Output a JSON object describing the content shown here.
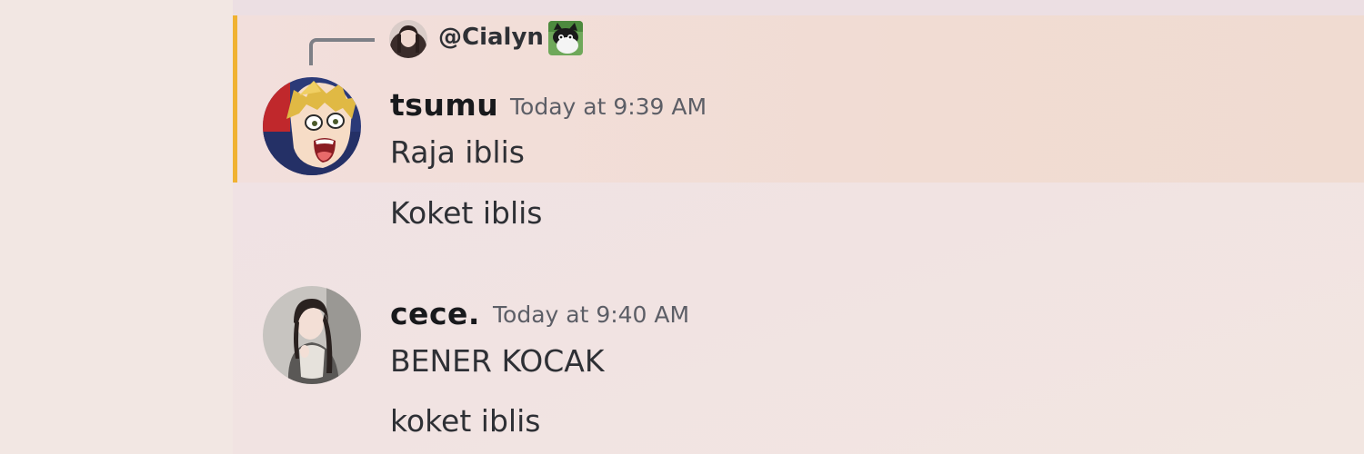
{
  "reply_preview": {
    "mention": "@Cialyn",
    "avatar_icon": "user-avatar",
    "emoji_icon": "cat-emoji"
  },
  "messages": [
    {
      "username": "tsumu",
      "timestamp": "Today at 9:39 AM",
      "avatar_icon": "anime-avatar",
      "lines": [
        "Raja iblis",
        "Koket iblis"
      ],
      "mentioned": true
    },
    {
      "username": "cece.",
      "timestamp": "Today at 9:40 AM",
      "avatar_icon": "user-avatar",
      "lines": [
        "BENER KOCAK",
        "koket iblis"
      ],
      "mentioned": false
    }
  ],
  "colors": {
    "mention_bar": "#f0b232",
    "mention_highlight": "#f1dcd3",
    "background": "#f1e6e3"
  }
}
